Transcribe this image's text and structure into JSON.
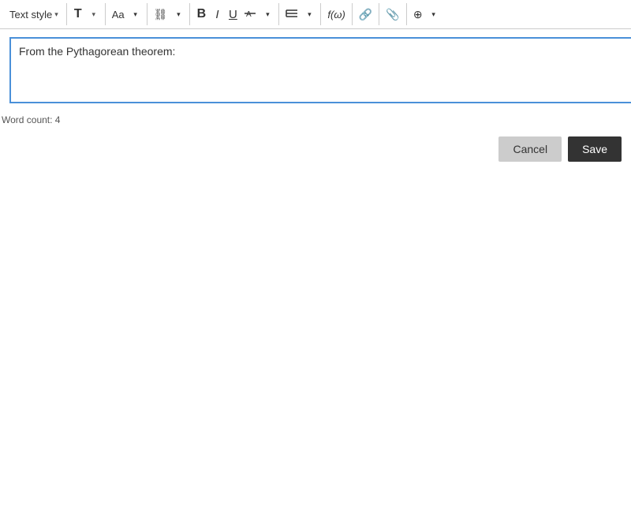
{
  "toolbar": {
    "text_style_label": "Text style",
    "bold_label": "B",
    "italic_label": "I",
    "underline_label": "U",
    "strikethrough_label": "S",
    "groups": [
      {
        "id": "text-style",
        "items": [
          "Text style"
        ]
      },
      {
        "id": "format-T",
        "items": [
          "T"
        ]
      },
      {
        "id": "format-Aa",
        "items": [
          "Aa"
        ]
      },
      {
        "id": "format-link-style",
        "items": [
          "link"
        ]
      },
      {
        "id": "format-bold",
        "items": [
          "B"
        ]
      },
      {
        "id": "format-italic",
        "items": [
          "I"
        ]
      },
      {
        "id": "format-underline",
        "items": [
          "U"
        ]
      },
      {
        "id": "format-strikethrough",
        "items": [
          "S"
        ]
      },
      {
        "id": "format-list",
        "items": [
          "list"
        ]
      },
      {
        "id": "format-fn",
        "items": [
          "fn"
        ]
      },
      {
        "id": "format-link",
        "items": [
          "link2"
        ]
      },
      {
        "id": "format-clip",
        "items": [
          "clip"
        ]
      },
      {
        "id": "format-plus",
        "items": [
          "plus"
        ]
      }
    ]
  },
  "editor": {
    "content": "From the Pythagorean theorem:",
    "placeholder": ""
  },
  "word_count": {
    "label": "Word count: 4"
  },
  "buttons": {
    "cancel_label": "Cancel",
    "save_label": "Save"
  }
}
